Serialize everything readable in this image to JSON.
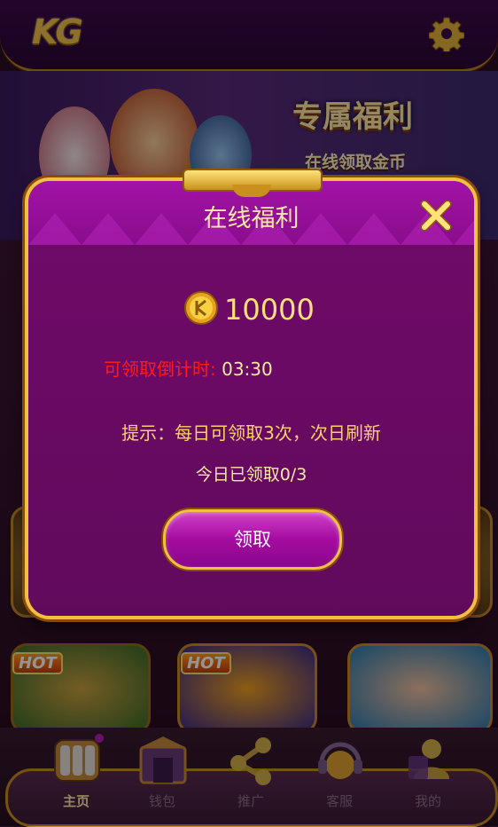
{
  "header": {
    "logo_text": "KG",
    "settings_icon": "gear-icon"
  },
  "banner": {
    "title": "专属福利",
    "subtitle": "在线领取金币"
  },
  "modal": {
    "title": "在线福利",
    "close_icon": "close-icon",
    "coin_icon": "coin-icon",
    "amount": "10000",
    "countdown_label": "可领取倒计时:",
    "countdown_value": "03:30",
    "tip": "提示：每日可领取3次，次日刷新",
    "today_claimed": "今日已领取0/3",
    "claim_label": "领取"
  },
  "games": {
    "hot_label": "HOT"
  },
  "bottom_nav": {
    "items": [
      {
        "label": "主页",
        "icon": "slot-machine-icon",
        "active": true
      },
      {
        "label": "钱包",
        "icon": "wallet-icon",
        "active": false
      },
      {
        "label": "推广",
        "icon": "share-icon",
        "active": false
      },
      {
        "label": "客服",
        "icon": "headset-icon",
        "active": false
      },
      {
        "label": "我的",
        "icon": "user-icon",
        "active": false
      }
    ]
  },
  "colors": {
    "modal_bg": "#7a0a72",
    "gold_border": "#f0c040",
    "countdown_label": "#ff1a1a",
    "text_gold": "#ffe9a8"
  }
}
